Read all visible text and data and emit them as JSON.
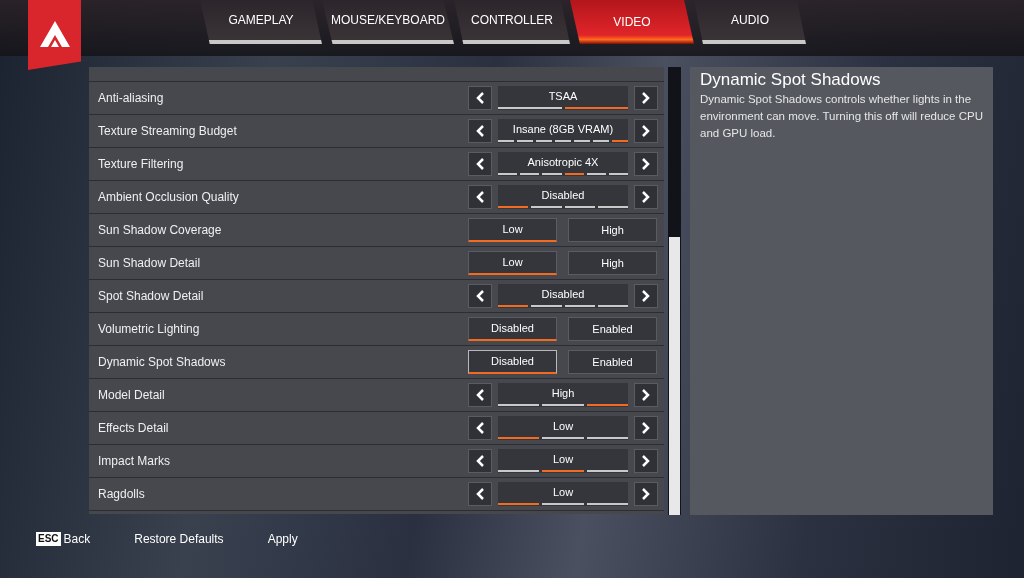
{
  "tabs": [
    {
      "label": "GAMEPLAY",
      "selected": false
    },
    {
      "label": "MOUSE/KEYBOARD",
      "selected": false
    },
    {
      "label": "CONTROLLER",
      "selected": false
    },
    {
      "label": "VIDEO",
      "selected": true
    },
    {
      "label": "AUDIO",
      "selected": false
    }
  ],
  "settings": [
    {
      "kind": "selector",
      "label": "Anti-aliasing",
      "value": "TSAA",
      "segments": [
        {
          "selected": false
        },
        {
          "selected": true
        }
      ]
    },
    {
      "kind": "selector",
      "label": "Texture Streaming Budget",
      "value": "Insane (8GB VRAM)",
      "segments": [
        {
          "selected": false
        },
        {
          "selected": false
        },
        {
          "selected": false
        },
        {
          "selected": false
        },
        {
          "selected": false
        },
        {
          "selected": false
        },
        {
          "selected": true
        }
      ]
    },
    {
      "kind": "selector",
      "label": "Texture Filtering",
      "value": "Anisotropic 4X",
      "segments": [
        {
          "selected": false
        },
        {
          "selected": false
        },
        {
          "selected": false
        },
        {
          "selected": true
        },
        {
          "selected": false
        },
        {
          "selected": false
        }
      ]
    },
    {
      "kind": "selector",
      "label": "Ambient Occlusion Quality",
      "value": "Disabled",
      "segments": [
        {
          "selected": true
        },
        {
          "selected": false
        },
        {
          "selected": false
        },
        {
          "selected": false
        }
      ]
    },
    {
      "kind": "toggle",
      "label": "Sun Shadow Coverage",
      "options": [
        {
          "label": "Low",
          "selected": true,
          "focused": false
        },
        {
          "label": "High",
          "selected": false,
          "focused": false
        }
      ]
    },
    {
      "kind": "toggle",
      "label": "Sun Shadow Detail",
      "options": [
        {
          "label": "Low",
          "selected": true,
          "focused": false
        },
        {
          "label": "High",
          "selected": false,
          "focused": false
        }
      ]
    },
    {
      "kind": "selector",
      "label": "Spot Shadow Detail",
      "value": "Disabled",
      "segments": [
        {
          "selected": true
        },
        {
          "selected": false
        },
        {
          "selected": false
        },
        {
          "selected": false
        }
      ]
    },
    {
      "kind": "toggle",
      "label": "Volumetric Lighting",
      "options": [
        {
          "label": "Disabled",
          "selected": true,
          "focused": false
        },
        {
          "label": "Enabled",
          "selected": false,
          "focused": false
        }
      ]
    },
    {
      "kind": "toggle",
      "label": "Dynamic Spot Shadows",
      "options": [
        {
          "label": "Disabled",
          "selected": true,
          "focused": true
        },
        {
          "label": "Enabled",
          "selected": false,
          "focused": false
        }
      ]
    },
    {
      "kind": "selector",
      "label": "Model Detail",
      "value": "High",
      "segments": [
        {
          "selected": false
        },
        {
          "selected": false
        },
        {
          "selected": true
        }
      ]
    },
    {
      "kind": "selector",
      "label": "Effects Detail",
      "value": "Low",
      "segments": [
        {
          "selected": true
        },
        {
          "selected": false
        },
        {
          "selected": false
        }
      ]
    },
    {
      "kind": "selector",
      "label": "Impact Marks",
      "value": "Low",
      "segments": [
        {
          "selected": false
        },
        {
          "selected": true
        },
        {
          "selected": false
        }
      ]
    },
    {
      "kind": "selector",
      "label": "Ragdolls",
      "value": "Low",
      "segments": [
        {
          "selected": true
        },
        {
          "selected": false
        },
        {
          "selected": false
        }
      ]
    }
  ],
  "description": {
    "title": "Dynamic Spot Shadows",
    "text": "Dynamic Spot Shadows controls whether lights in the environment can move. Turning this off will reduce CPU and GPU load."
  },
  "footer": {
    "key": "ESC",
    "back": "Back",
    "restore": "Restore Defaults",
    "apply": "Apply"
  }
}
